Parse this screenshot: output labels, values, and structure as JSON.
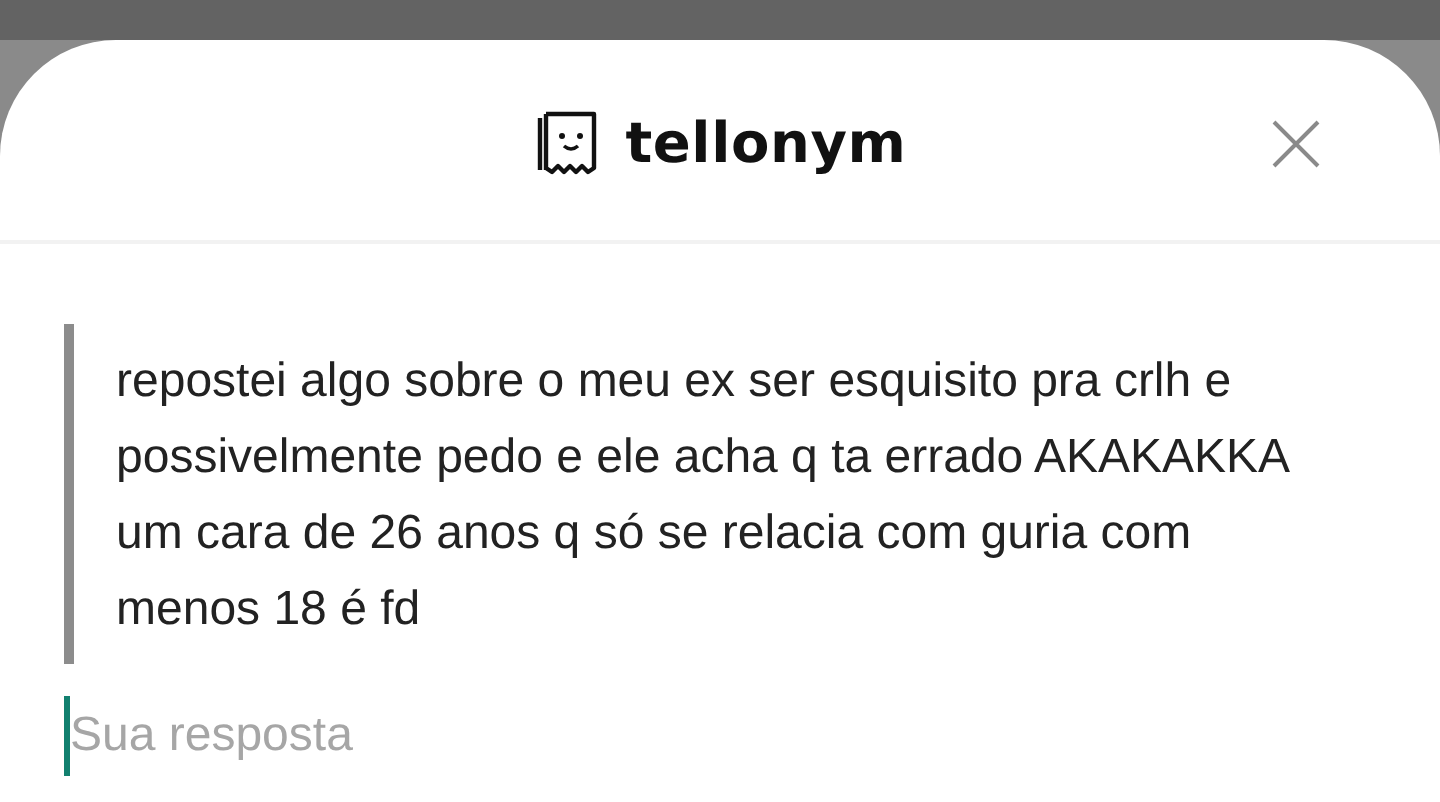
{
  "header": {
    "logo_text": "tellonym"
  },
  "tell": {
    "text": "repostei algo sobre o meu ex ser esquisito pra crlh e possivelmente pedo e ele acha q ta errado AKAKAKKA um cara de 26 anos q só se relacia com guria com menos 18 é fd"
  },
  "answer": {
    "placeholder": "Sua resposta"
  }
}
